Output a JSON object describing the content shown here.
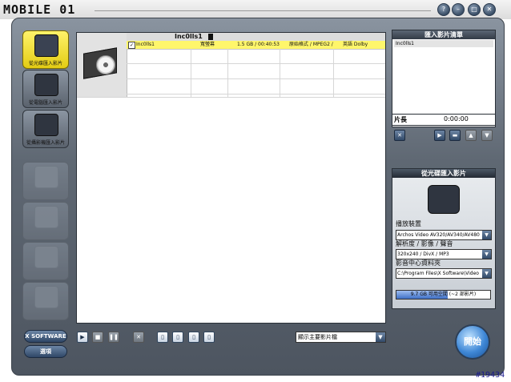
{
  "titlebar": {
    "logo": "MOBILE 01",
    "buttons": [
      "?",
      "–",
      "□",
      "✕"
    ]
  },
  "sidebar": {
    "modes": [
      {
        "label": "從光碟匯入影片",
        "icon": "disc-mascot-icon",
        "state": "active"
      },
      {
        "label": "從電腦匯入影片",
        "icon": "computer-film-icon",
        "state": "normal"
      },
      {
        "label": "從攝影機匯入影片",
        "icon": "camcorder-icon",
        "state": "normal"
      }
    ],
    "disabled_steps": [
      {
        "icon": "burn-disc-icon"
      },
      {
        "icon": "edit-film-icon"
      },
      {
        "icon": "edit-notes-icon"
      },
      {
        "icon": "export-icon"
      }
    ],
    "xsoftware_label": "X SOFTWARE",
    "options_label": "選項"
  },
  "file_list": {
    "group_title": "Inc0lls1",
    "row": {
      "name": "Inc0lls1",
      "aspect": "寬螢幕",
      "size_duration": "1.5 GB / 00:40:53",
      "format": "原始格式 / MPEG2 /",
      "audio": "英語 Dolby"
    }
  },
  "toolbar": {
    "view_select_value": "顯示主要影片檔"
  },
  "import_list": {
    "title": "匯入影片清單",
    "items": [
      "Inc0lls1"
    ],
    "length_label": "片長",
    "length_value": "0:00:00"
  },
  "disc_panel": {
    "title": "從光碟匯入影片",
    "device_label": "播放裝置",
    "device_value": "Archos Video AV320/AV340/AV480",
    "quality_label": "解析度 / 影像 / 聲音",
    "quality_value": "320x240 / DivX / MP3",
    "folder_label": "影音中心資料夾",
    "folder_value": "C:\\Program Files\\X Software\\Video W",
    "space_text": "9.7 GB 可用空間 (~2 部影片)",
    "space_fraction": 0.55
  },
  "start_label": "開始",
  "version": "#19434"
}
